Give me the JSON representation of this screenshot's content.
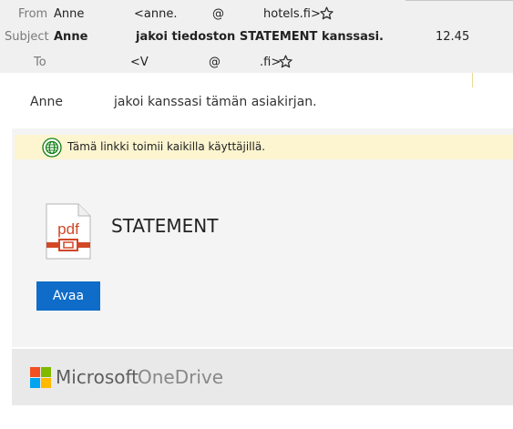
{
  "header": {
    "from": {
      "label": "From",
      "name": "Anne",
      "email_start": "<anne.",
      "at": "@",
      "email_end": "hotels.fi>"
    },
    "subject": {
      "label": "Subject",
      "sender": "Anne",
      "text": "jakoi tiedoston STATEMENT kanssasi.",
      "time": "12.45"
    },
    "to": {
      "label": "To",
      "email_start": "<V",
      "at": "@",
      "email_end": ".fi>"
    }
  },
  "body": {
    "intro_name": "Anne",
    "intro_text": "jakoi kanssasi tämän asiakirjan.",
    "banner_text": "Tämä linkki toimii kaikilla käyttäjillä.",
    "file_name": "STATEMENT",
    "file_icon_label": "pdf",
    "open_label": "Avaa"
  },
  "footer": {
    "microsoft": "Microsoft",
    "onedrive": "OneDrive",
    "logo_colors": [
      "#f25022",
      "#7fba00",
      "#00a4ef",
      "#ffb900"
    ]
  },
  "colors": {
    "accent_button": "#0f6cc9",
    "banner_bg": "#fcf5d0",
    "pdf_red": "#d24726",
    "globe_green": "#107c10"
  }
}
